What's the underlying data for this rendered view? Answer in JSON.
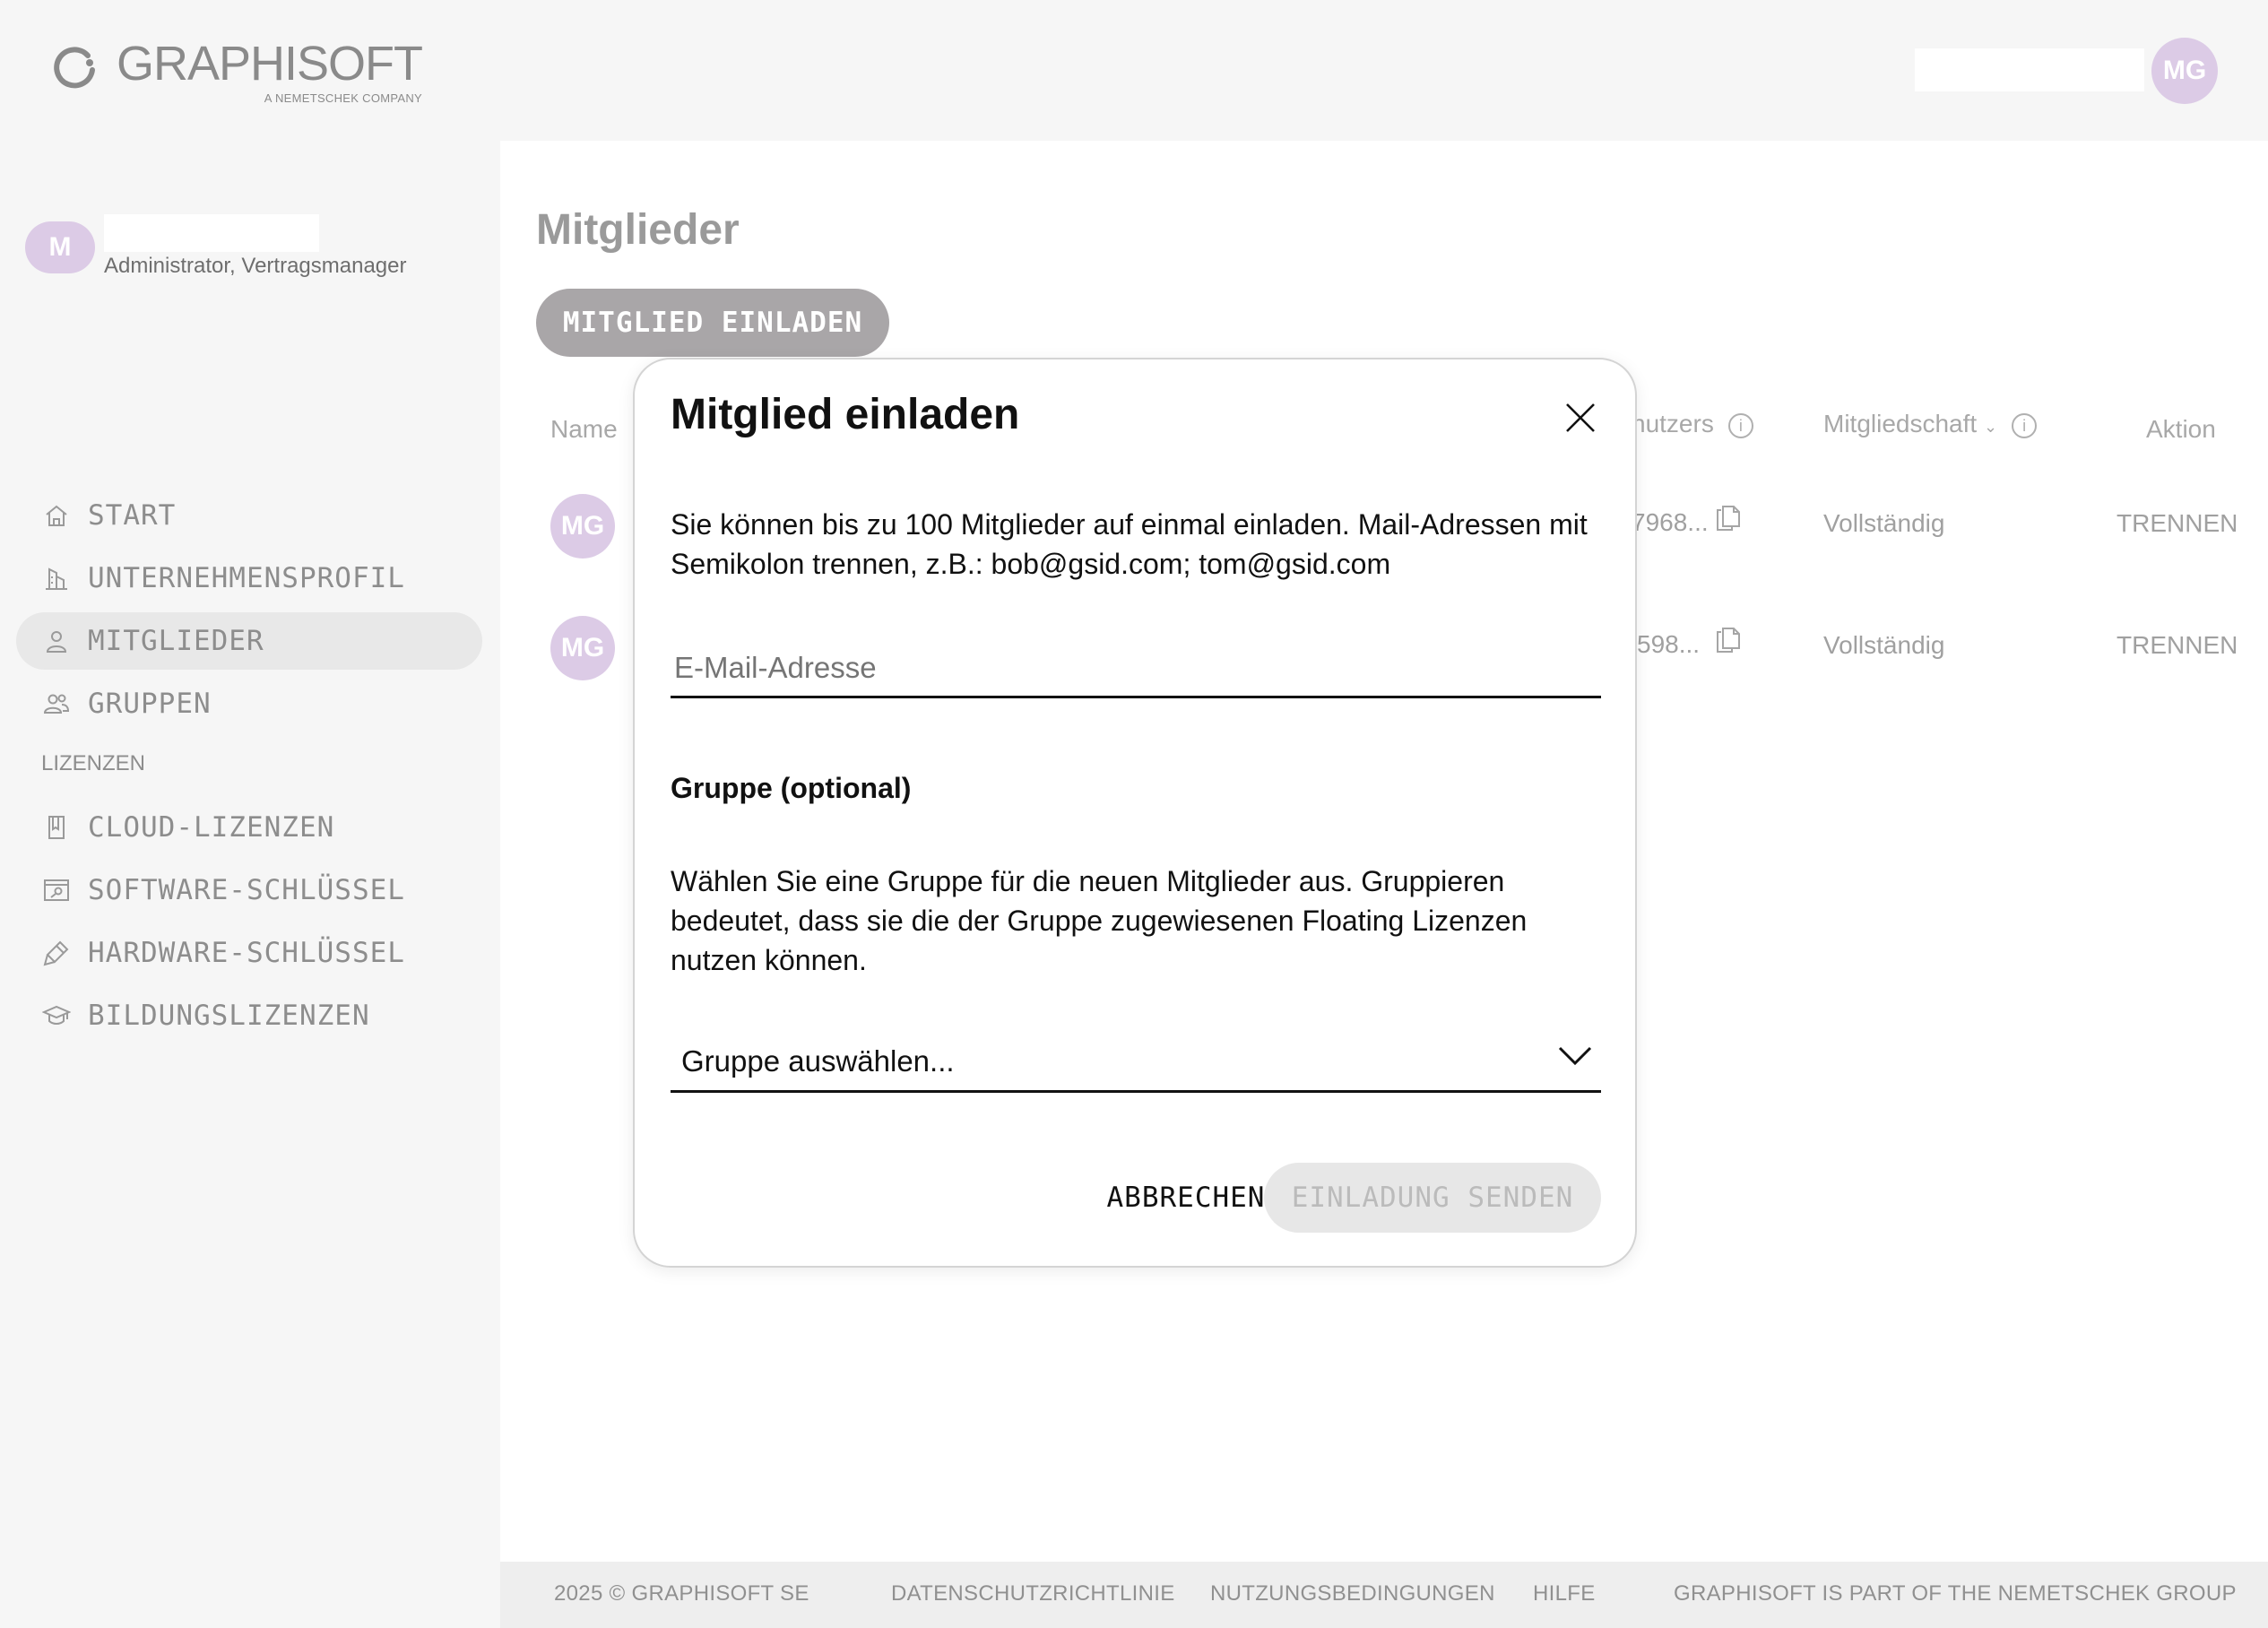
{
  "header": {
    "logo_word": "GRAPHISOFT",
    "logo_tagline": "A NEMETSCHEK COMPANY",
    "avatar_initials": "MG"
  },
  "sidebar": {
    "user": {
      "initial": "M",
      "role": "Administrator, Vertragsmanager"
    },
    "items": [
      {
        "label": "START",
        "icon": "home-icon"
      },
      {
        "label": "UNTERNEHMENSPROFIL",
        "icon": "building-icon"
      },
      {
        "label": "MITGLIEDER",
        "icon": "person-icon",
        "active": true
      },
      {
        "label": "GRUPPEN",
        "icon": "people-icon"
      }
    ],
    "section_label": "LIZENZEN",
    "license_items": [
      {
        "label": "CLOUD-LIZENZEN",
        "icon": "book-icon"
      },
      {
        "label": "SOFTWARE-SCHLÜSSEL",
        "icon": "key-window-icon"
      },
      {
        "label": "HARDWARE-SCHLÜSSEL",
        "icon": "usb-key-icon"
      },
      {
        "label": "BILDUNGSLIZENZEN",
        "icon": "graduation-cap-icon"
      }
    ]
  },
  "main": {
    "title": "Mitglieder",
    "invite_button": "MITGLIED EINLADEN",
    "table": {
      "headers": {
        "name": "Name",
        "user_id": "nutzers",
        "membership": "Mitgliedschaft",
        "action": "Aktion"
      },
      "rows": [
        {
          "avatar": "MG",
          "id_fragment": "7968...",
          "membership": "Vollständig",
          "action": "TRENNEN"
        },
        {
          "avatar": "MG",
          "id_fragment": "598...",
          "membership": "Vollständig",
          "action": "TRENNEN"
        }
      ]
    }
  },
  "modal": {
    "title": "Mitglied einladen",
    "description": "Sie können bis zu 100 Mitglieder auf einmal einladen. Mail-Adressen mit Semikolon trennen, z.B.: bob@gsid.com; tom@gsid.com",
    "email_placeholder": "E-Mail-Adresse",
    "email_value": "",
    "group_label": "Gruppe (optional)",
    "group_description": "Wählen Sie eine Gruppe für die neuen Mitglieder aus. Gruppieren bedeutet, dass sie die der Gruppe zugewiesenen Floating Lizenzen nutzen können.",
    "group_select_value": "Gruppe auswählen...",
    "cancel_label": "ABBRECHEN",
    "send_label": "EINLADUNG SENDEN"
  },
  "footer": {
    "copyright": "2025 © GRAPHISOFT SE",
    "privacy": "DATENSCHUTZRICHTLINIE",
    "terms": "NUTZUNGSBEDINGUNGEN",
    "help": "HILFE",
    "group_note": "GRAPHISOFT IS PART OF THE NEMETSCHEK GROUP"
  },
  "colors": {
    "avatar": "#dccbe6",
    "invite_button": "#a9a6a8",
    "send_disabled": "#e7e7e7"
  }
}
